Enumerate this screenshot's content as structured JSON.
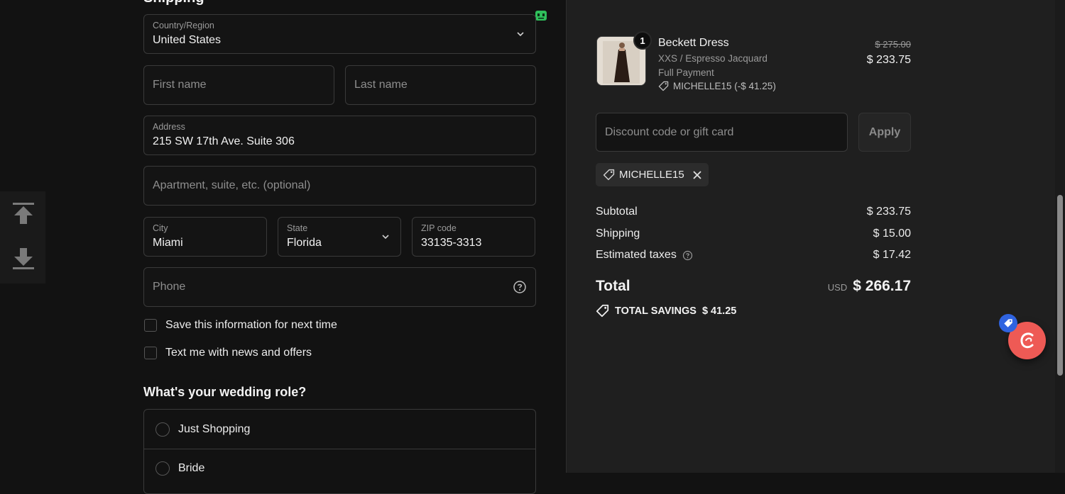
{
  "shipping": {
    "section_title": "Shipping",
    "country": {
      "label": "Country/Region",
      "value": "United States"
    },
    "first_name": {
      "placeholder": "First name"
    },
    "last_name": {
      "placeholder": "Last name"
    },
    "address": {
      "label": "Address",
      "value": "215 SW 17th Ave. Suite 306"
    },
    "apartment": {
      "placeholder": "Apartment, suite, etc. (optional)"
    },
    "city": {
      "label": "City",
      "value": "Miami"
    },
    "state": {
      "label": "State",
      "value": "Florida"
    },
    "zip": {
      "label": "ZIP code",
      "value": "33135-3313"
    },
    "phone": {
      "placeholder": "Phone"
    },
    "save_info_label": "Save this information for next time",
    "text_me_label": "Text me with news and offers"
  },
  "wedding_role": {
    "question": "What's your wedding role?",
    "options": [
      "Just Shopping",
      "Bride"
    ]
  },
  "order": {
    "item": {
      "name": "Beckett Dress",
      "variant": "XXS / Espresso Jacquard",
      "payment": "Full Payment",
      "discount": "MICHELLE15 (-$ 41.25)",
      "quantity": "1",
      "original_price": "$ 275.00",
      "price": "$ 233.75"
    },
    "discount_placeholder": "Discount code or gift card",
    "apply_label": "Apply",
    "applied_code": "MICHELLE15",
    "subtotal_label": "Subtotal",
    "subtotal": "$ 233.75",
    "shipping_label": "Shipping",
    "shipping": "$ 15.00",
    "taxes_label": "Estimated taxes",
    "taxes": "$ 17.42",
    "total_label": "Total",
    "currency": "USD",
    "total": "$ 266.17",
    "savings_label": "TOTAL SAVINGS",
    "savings": "$ 41.25"
  },
  "colors": {
    "left_bg": "#121212",
    "right_bg": "#1f1f1f",
    "chat_button": "#ee5a55",
    "chat_badge": "#2f63e0"
  }
}
